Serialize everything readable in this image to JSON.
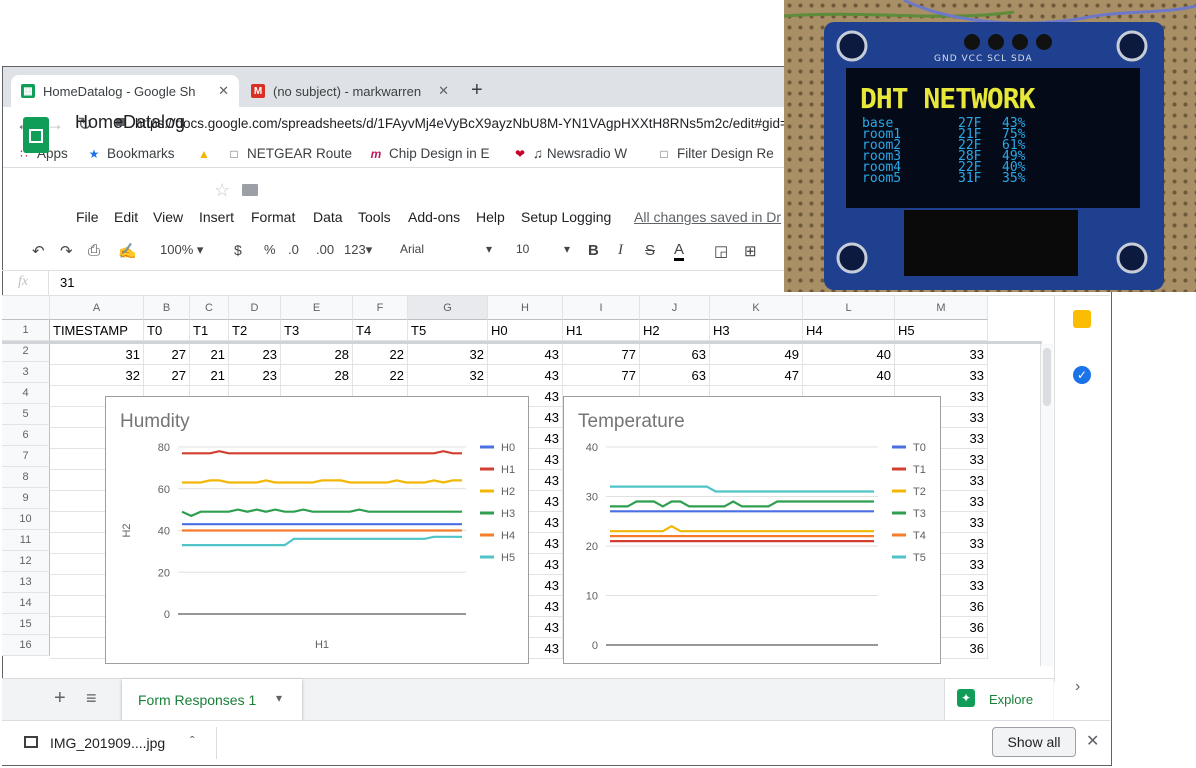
{
  "tabs": [
    {
      "label": "HomeDatalog - Google Sh",
      "icon": "sheets-icon",
      "active": true
    },
    {
      "label": "(no subject) - markwarren",
      "icon": "gmail-icon",
      "active": false
    }
  ],
  "new_tab": "+",
  "url": "https://docs.google.com/spreadsheets/d/1FAyvMj4eVyBcX9ayzNbU8M-YN1VAgpHXXtH8RNs5m2c/edit#gid=1",
  "bookmarks": [
    {
      "label": "Apps",
      "icon": "apps-grid-icon"
    },
    {
      "label": "Bookmarks",
      "icon": "star-icon"
    },
    {
      "label": "",
      "icon": "google-drive-icon"
    },
    {
      "label": "NETGEAR Route",
      "icon": "page-icon"
    },
    {
      "label": "Chip Design in E",
      "icon": "m-logo-icon"
    },
    {
      "label": "♫ Newsradio W",
      "icon": "iheart-icon"
    },
    {
      "label": "Filter Design Re",
      "icon": "page-icon"
    }
  ],
  "sheet_title": "HomeDatalog",
  "menu": [
    "File",
    "Edit",
    "View",
    "Insert",
    "Format",
    "Data",
    "Tools",
    "Add-ons",
    "Help",
    "Setup Logging"
  ],
  "save_status": "All changes saved in Dr",
  "toolbar": {
    "zoom": "100%",
    "currency": "$",
    "percent": "%",
    "dec_less": ".0",
    "dec_more": ".00",
    "number_format": "123",
    "font": "Arial",
    "font_size": "10"
  },
  "formula_bar": {
    "fx": "fx",
    "value": "31"
  },
  "columns": [
    {
      "letter": "A",
      "header": "TIMESTAMP"
    },
    {
      "letter": "B",
      "header": "T0"
    },
    {
      "letter": "C",
      "header": "T1"
    },
    {
      "letter": "D",
      "header": "T2"
    },
    {
      "letter": "E",
      "header": "T3"
    },
    {
      "letter": "F",
      "header": "T4"
    },
    {
      "letter": "G",
      "header": "T5"
    },
    {
      "letter": "H",
      "header": "H0"
    },
    {
      "letter": "I",
      "header": "H1"
    },
    {
      "letter": "J",
      "header": "H2"
    },
    {
      "letter": "K",
      "header": "H3"
    },
    {
      "letter": "L",
      "header": "H4"
    },
    {
      "letter": "M",
      "header": "H5"
    }
  ],
  "row_numbers": [
    "1",
    "2",
    "3",
    "4",
    "5",
    "6",
    "7",
    "8",
    "9",
    "10",
    "11",
    "12",
    "13",
    "14",
    "15",
    "16"
  ],
  "rows": [
    [
      "31",
      "27",
      "21",
      "23",
      "28",
      "22",
      "32",
      "43",
      "77",
      "63",
      "49",
      "40",
      "33"
    ],
    [
      "32",
      "27",
      "21",
      "23",
      "28",
      "22",
      "32",
      "43",
      "77",
      "63",
      "47",
      "40",
      "33"
    ]
  ],
  "col_h_visible": [
    "43",
    "43",
    "43",
    "43",
    "43",
    "43",
    "43",
    "43",
    "43",
    "43",
    "43",
    "43",
    "43",
    "43"
  ],
  "col_m_visible": [
    "33",
    "33",
    "33",
    "33",
    "33",
    "33",
    "33",
    "33",
    "33",
    "33",
    "36",
    "36",
    "36"
  ],
  "chart_data": [
    {
      "type": "line",
      "title": "Humdity",
      "xlabel": "H1",
      "ylabel": "H2",
      "ylim": [
        0,
        80
      ],
      "yticks": [
        "0",
        "20",
        "40",
        "60",
        "80"
      ],
      "legend_position": "right",
      "series": [
        {
          "name": "H0",
          "color": "#4a6fe3",
          "values": [
            43,
            43,
            43,
            43,
            43,
            43,
            43,
            43,
            43,
            43,
            43,
            43,
            43,
            43,
            43,
            43,
            43,
            43,
            43,
            43,
            43,
            43,
            43,
            43,
            43,
            43,
            43,
            43,
            43,
            43,
            43
          ]
        },
        {
          "name": "H1",
          "color": "#d23f31",
          "values": [
            77,
            77,
            77,
            77,
            78,
            77,
            77,
            77,
            77,
            77,
            77,
            77,
            77,
            77,
            77,
            77,
            77,
            77,
            77,
            77,
            77,
            77,
            77,
            77,
            77,
            77,
            77,
            77,
            78,
            77,
            77
          ]
        },
        {
          "name": "H2",
          "color": "#f2b705",
          "values": [
            63,
            63,
            63,
            64,
            64,
            63,
            63,
            63,
            63,
            64,
            63,
            63,
            63,
            63,
            63,
            64,
            64,
            64,
            63,
            63,
            63,
            63,
            63,
            64,
            63,
            63,
            63,
            64,
            63,
            64,
            64
          ]
        },
        {
          "name": "H3",
          "color": "#2e9e4f",
          "values": [
            49,
            47,
            49,
            49,
            49,
            49,
            50,
            49,
            50,
            49,
            50,
            49,
            49,
            50,
            49,
            49,
            49,
            49,
            49,
            50,
            49,
            49,
            49,
            49,
            49,
            49,
            49,
            49,
            49,
            49,
            49
          ]
        },
        {
          "name": "H4",
          "color": "#f57c2a",
          "values": [
            40,
            40,
            40,
            40,
            40,
            40,
            40,
            40,
            40,
            40,
            40,
            40,
            40,
            40,
            40,
            40,
            40,
            40,
            40,
            40,
            40,
            40,
            40,
            40,
            40,
            40,
            40,
            40,
            40,
            40,
            40
          ]
        },
        {
          "name": "H5",
          "color": "#4fc3c7",
          "values": [
            33,
            33,
            33,
            33,
            33,
            33,
            33,
            33,
            33,
            33,
            33,
            33,
            36,
            36,
            36,
            36,
            36,
            36,
            36,
            36,
            36,
            36,
            36,
            36,
            36,
            36,
            36,
            37,
            37,
            37,
            37
          ]
        }
      ]
    },
    {
      "type": "line",
      "title": "Temperature",
      "xlabel": "",
      "ylabel": "",
      "ylim": [
        0,
        40
      ],
      "yticks": [
        "0",
        "10",
        "20",
        "30",
        "40"
      ],
      "legend_position": "right",
      "series": [
        {
          "name": "T0",
          "color": "#4a6fe3",
          "values": [
            27,
            27,
            27,
            27,
            27,
            27,
            27,
            27,
            27,
            27,
            27,
            27,
            27,
            27,
            27,
            27,
            27,
            27,
            27,
            27,
            27,
            27,
            27,
            27,
            27,
            27,
            27,
            27,
            27,
            27,
            27
          ]
        },
        {
          "name": "T1",
          "color": "#d23f31",
          "values": [
            21,
            21,
            21,
            21,
            21,
            21,
            21,
            21,
            21,
            21,
            21,
            21,
            21,
            21,
            21,
            21,
            21,
            21,
            21,
            21,
            21,
            21,
            21,
            21,
            21,
            21,
            21,
            21,
            21,
            21,
            21
          ]
        },
        {
          "name": "T2",
          "color": "#f2b705",
          "values": [
            23,
            23,
            23,
            23,
            23,
            23,
            23,
            24,
            23,
            23,
            23,
            23,
            23,
            23,
            23,
            23,
            23,
            23,
            23,
            23,
            23,
            23,
            23,
            23,
            23,
            23,
            23,
            23,
            23,
            23,
            23
          ]
        },
        {
          "name": "T3",
          "color": "#2e9e4f",
          "values": [
            28,
            28,
            28,
            29,
            29,
            29,
            28,
            29,
            29,
            28,
            28,
            28,
            28,
            28,
            29,
            28,
            28,
            28,
            28,
            29,
            29,
            29,
            29,
            29,
            29,
            29,
            29,
            29,
            29,
            29,
            29
          ]
        },
        {
          "name": "T4",
          "color": "#f57c2a",
          "values": [
            22,
            22,
            22,
            22,
            22,
            22,
            22,
            22,
            22,
            22,
            22,
            22,
            22,
            22,
            22,
            22,
            22,
            22,
            22,
            22,
            22,
            22,
            22,
            22,
            22,
            22,
            22,
            22,
            22,
            22,
            22
          ]
        },
        {
          "name": "T5",
          "color": "#4fc3c7",
          "values": [
            32,
            32,
            32,
            32,
            32,
            32,
            32,
            32,
            32,
            32,
            32,
            32,
            31,
            31,
            31,
            31,
            31,
            31,
            31,
            31,
            31,
            31,
            31,
            31,
            31,
            31,
            31,
            31,
            31,
            31,
            31
          ]
        }
      ]
    }
  ],
  "sheet_tab": "Form Responses 1",
  "explore": "Explore",
  "download": {
    "filename": "IMG_201909....jpg",
    "show_all": "Show all"
  },
  "oled": {
    "header": "GND VCC SCL SDA",
    "title": "DHT NETWORK",
    "lines": [
      {
        "name": "base",
        "temp": "27F",
        "hum": "43%"
      },
      {
        "name": "room1",
        "temp": "21F",
        "hum": "75%"
      },
      {
        "name": "room2",
        "temp": "22F",
        "hum": "61%"
      },
      {
        "name": "room3",
        "temp": "28F",
        "hum": "49%"
      },
      {
        "name": "room4",
        "temp": "22F",
        "hum": "40%"
      },
      {
        "name": "room5",
        "temp": "31F",
        "hum": "35%"
      }
    ]
  }
}
